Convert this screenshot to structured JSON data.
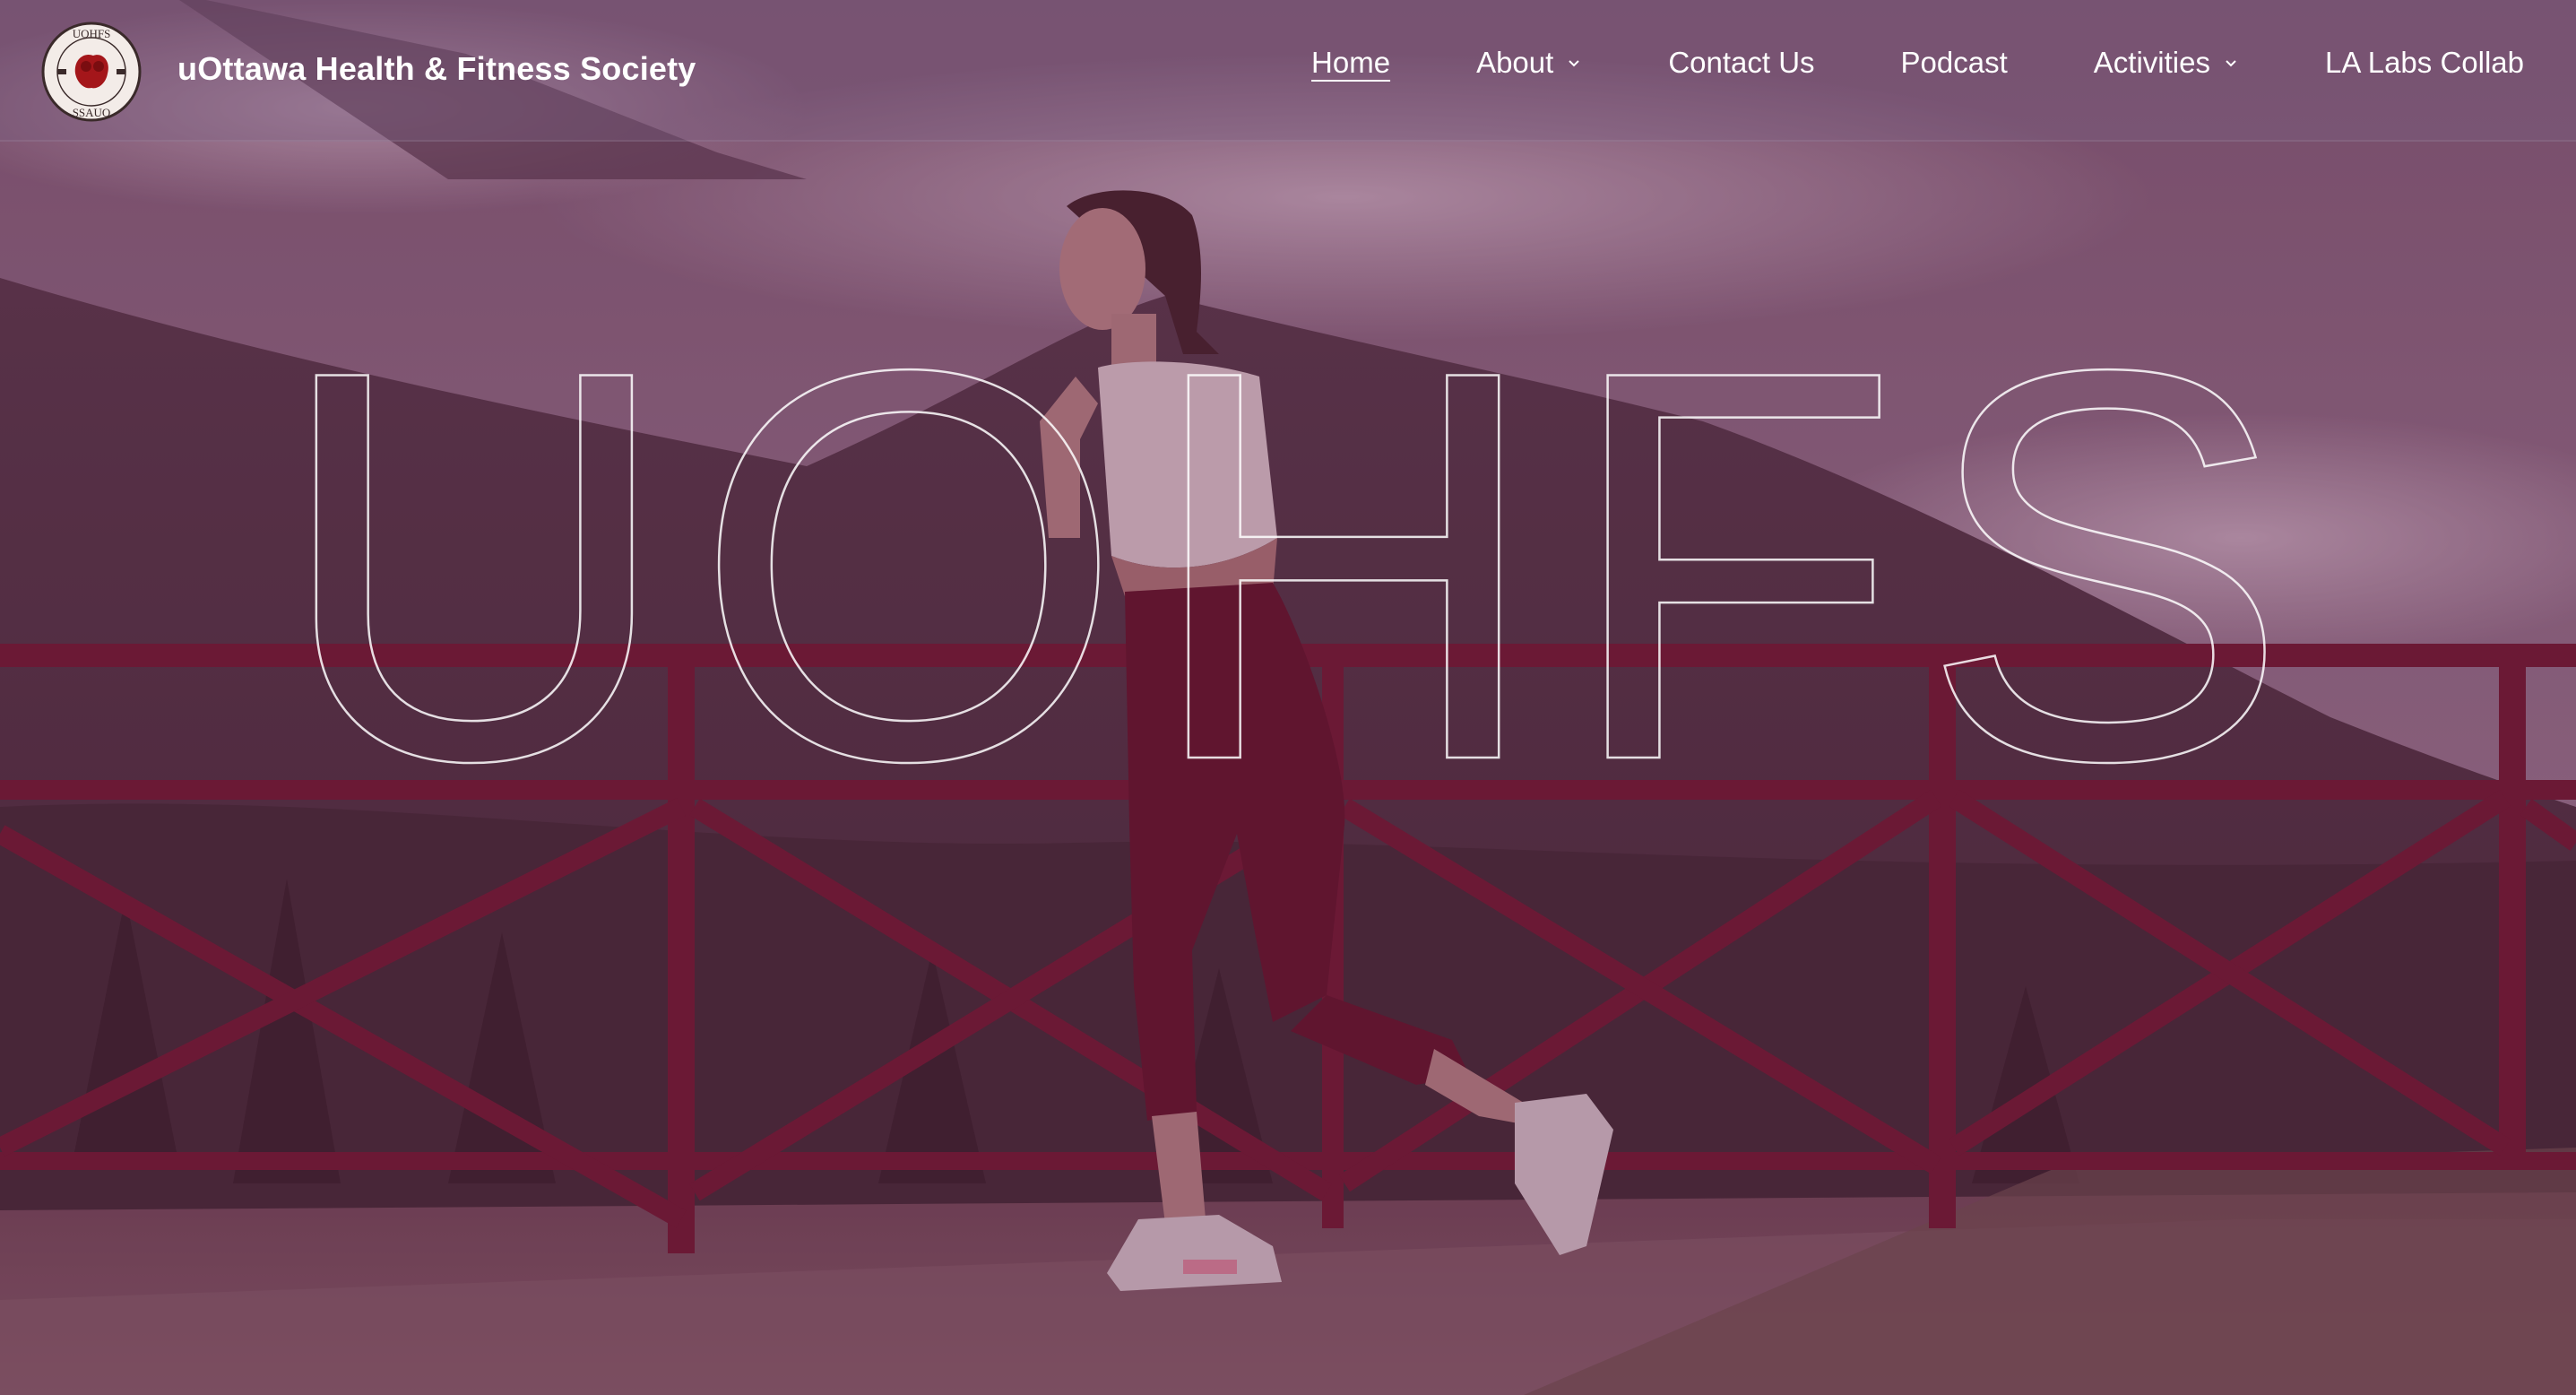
{
  "site": {
    "title": "uOttawa Health & Fitness Society",
    "logo_icon": "uohfs-logo-icon",
    "logo_text_top": "UOHFS",
    "logo_text_bottom": "SSAUO"
  },
  "nav": {
    "items": [
      {
        "label": "Home",
        "active": true,
        "has_dropdown": false
      },
      {
        "label": "About",
        "active": false,
        "has_dropdown": true
      },
      {
        "label": "Contact Us",
        "active": false,
        "has_dropdown": false
      },
      {
        "label": "Podcast",
        "active": false,
        "has_dropdown": false
      },
      {
        "label": "Activities",
        "active": false,
        "has_dropdown": true
      },
      {
        "label": "LA Labs Collab",
        "active": false,
        "has_dropdown": false
      }
    ]
  },
  "hero": {
    "headline": "UOHFS",
    "background_image": "woman-jogging-by-railing-mountains",
    "tint_color": "#6e1e46"
  },
  "colors": {
    "accent": "#7a1f3d",
    "text": "#ffffff"
  }
}
